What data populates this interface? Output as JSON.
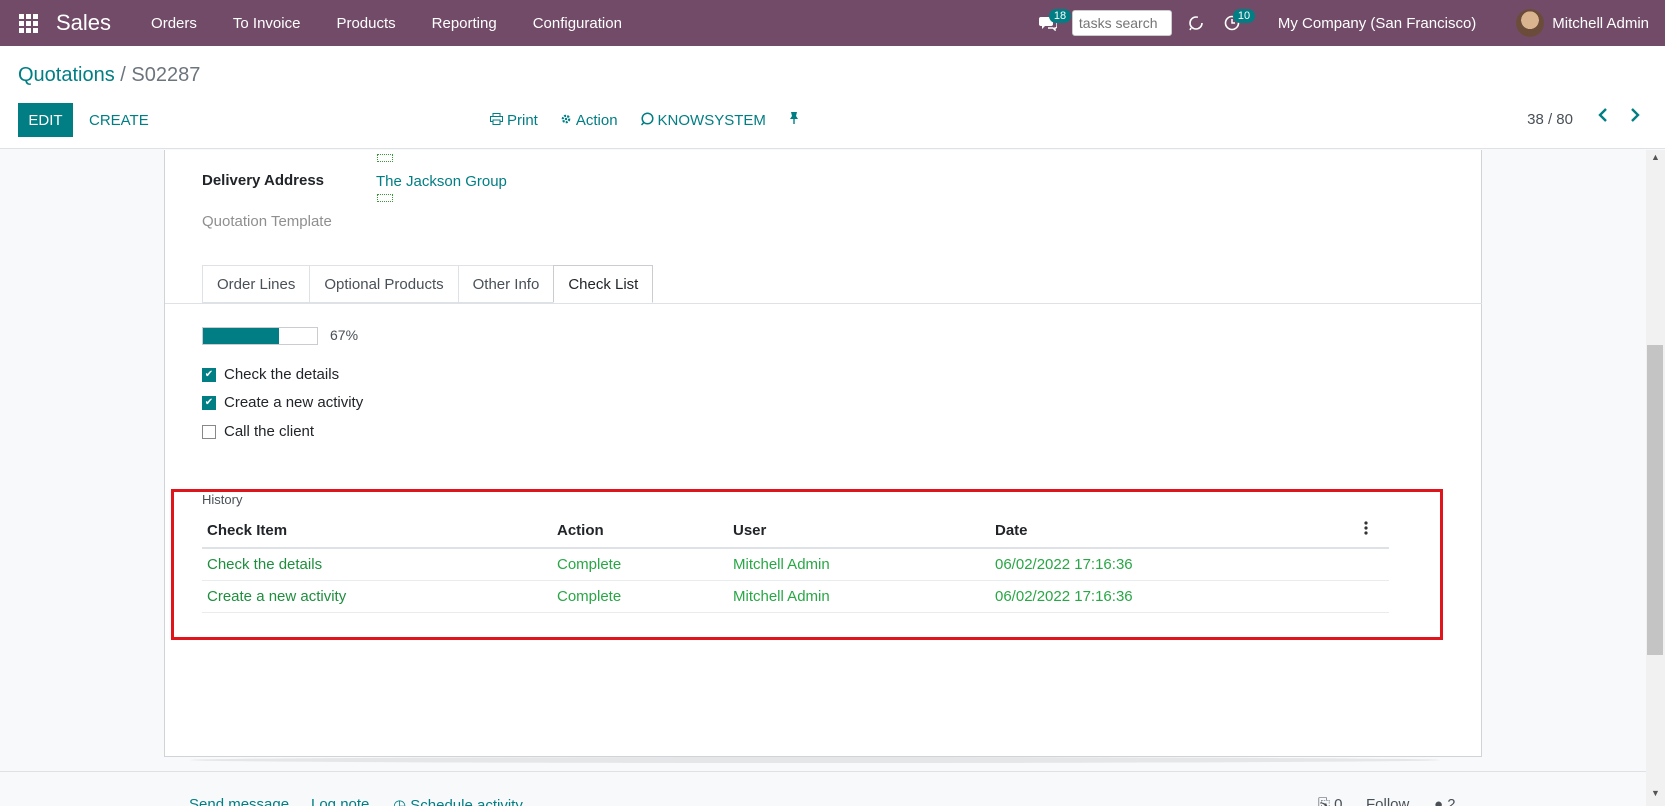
{
  "navbar": {
    "app_name": "Sales",
    "menu": [
      "Orders",
      "To Invoice",
      "Products",
      "Reporting",
      "Configuration"
    ],
    "messages_badge": "18",
    "search_placeholder": "tasks search",
    "activities_badge": "10",
    "company": "My Company (San Francisco)",
    "user": "Mitchell Admin"
  },
  "control_panel": {
    "breadcrumb_parent": "Quotations",
    "breadcrumb_sep": " / ",
    "breadcrumb_current": "S02287",
    "edit_label": "EDIT",
    "create_label": "CREATE",
    "print_label": "Print",
    "action_label": "Action",
    "knowsystem_label": "KNOWSYSTEM",
    "pager": "38 / 80"
  },
  "form": {
    "delivery_label": "Delivery Address",
    "delivery_value": "The Jackson Group",
    "template_label": "Quotation Template",
    "tabs": [
      "Order Lines",
      "Optional Products",
      "Other Info",
      "Check List"
    ],
    "active_tab": "Check List",
    "progress_percent": 67,
    "progress_text": "67%",
    "checklist": [
      {
        "label": "Check the details",
        "checked": true
      },
      {
        "label": "Create a new activity",
        "checked": true
      },
      {
        "label": "Call the client",
        "checked": false
      }
    ],
    "history_label": "History",
    "history_columns": [
      "Check Item",
      "Action",
      "User",
      "Date"
    ],
    "history_rows": [
      {
        "item": "Check the details",
        "action": "Complete",
        "user": "Mitchell Admin",
        "date": "06/02/2022 17:16:36"
      },
      {
        "item": "Create a new activity",
        "action": "Complete",
        "user": "Mitchell Admin",
        "date": "06/02/2022 17:16:36"
      }
    ]
  },
  "chatter": {
    "send_message": "Send message",
    "log_note": "Log note",
    "schedule_activity": "Schedule activity",
    "attachments": "0",
    "follow": "Follow",
    "followers": "2"
  },
  "colors": {
    "navbar": "#714b67",
    "accent": "#017e84",
    "highlight": "#e0151b",
    "history_text": "#28a745"
  }
}
